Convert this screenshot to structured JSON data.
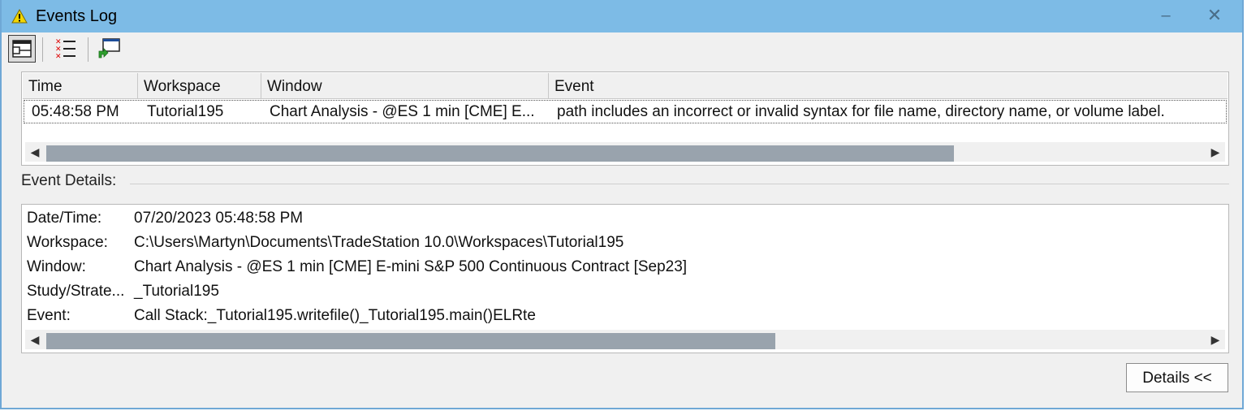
{
  "window": {
    "title": "Events Log",
    "minimize_glyph": "–",
    "close_glyph": "✕"
  },
  "toolbar": {
    "buttons": [
      {
        "icon": "window-layout-icon",
        "active": true
      },
      {
        "icon": "event-list-icon",
        "active": false
      },
      {
        "icon": "goto-window-icon",
        "active": false
      }
    ]
  },
  "events_table": {
    "columns": [
      "Time",
      "Workspace",
      "Window",
      "Event"
    ],
    "rows": [
      {
        "time": "05:48:58 PM",
        "workspace": "Tutorial195",
        "window": "Chart Analysis - @ES 1 min [CME] E...",
        "event": "path includes an incorrect or invalid syntax for file name, directory name, or volume label."
      }
    ],
    "scroll_left": "◀",
    "scroll_right": "▶"
  },
  "event_details": {
    "label": "Event Details:",
    "fields": [
      {
        "key": "Date/Time:",
        "value": "07/20/2023 05:48:58 PM"
      },
      {
        "key": "Workspace:",
        "value": "C:\\Users\\Martyn\\Documents\\TradeStation 10.0\\Workspaces\\Tutorial195"
      },
      {
        "key": "Window:",
        "value": "Chart Analysis - @ES 1 min [CME] E-mini S&P 500 Continuous Contract [Sep23]"
      },
      {
        "key": "Study/Strate...",
        "value": "_Tutorial195"
      },
      {
        "key": "Event:",
        "value": "Call Stack:_Tutorial195.writefile()_Tutorial195.main()ELRte"
      }
    ],
    "scroll_left": "◀",
    "scroll_right": "▶"
  },
  "buttons": {
    "details_label": "Details <<"
  },
  "colors": {
    "titlebar": "#7dbbe6",
    "scroll_thumb": "#99a3ad",
    "warning_icon": "#f2d600"
  }
}
